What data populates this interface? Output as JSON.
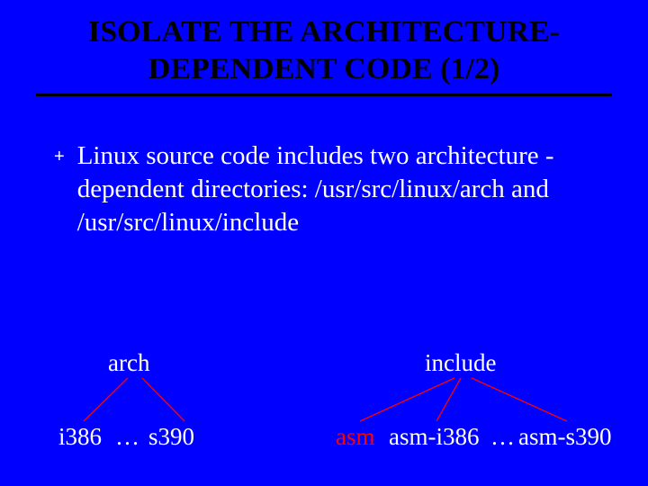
{
  "title": "ISOLATE THE ARCHITECTURE-DEPENDENT CODE (1/2)",
  "bullet": {
    "mark": "+",
    "text": "Linux source code includes two architecture -dependent directories: /usr/src/linux/arch and /usr/src/linux/include"
  },
  "tree": {
    "left": {
      "root": "arch",
      "children": [
        "i386",
        "…",
        "s390"
      ]
    },
    "right": {
      "root": "include",
      "children": [
        "asm",
        "asm-i386",
        "…",
        "asm-s390"
      ]
    }
  }
}
